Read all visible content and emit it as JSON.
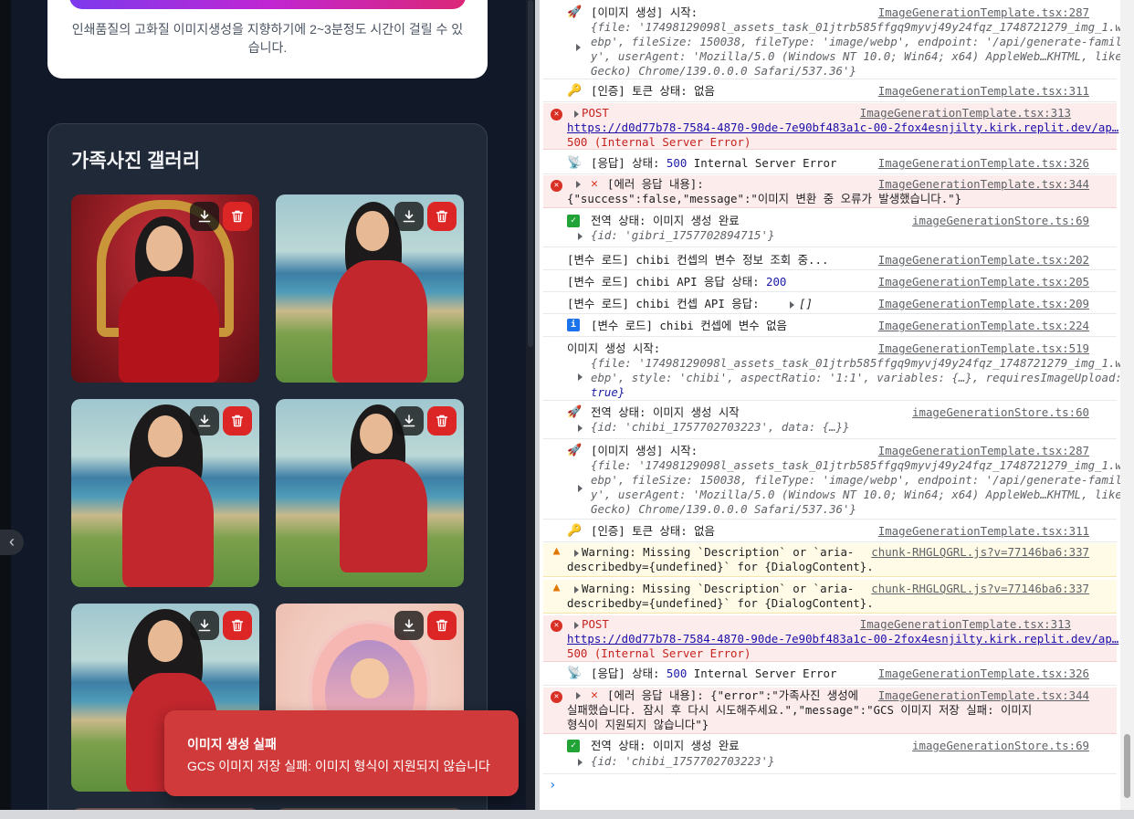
{
  "app": {
    "info_text": "인쇄품질의 고화질 이미지생성을 지향하기에 2~3분정도 시간이 걸릴 수 있습니다.",
    "gallery_title": "가족사진 갤러리",
    "toast": {
      "title": "이미지 생성 실패",
      "message": "GCS 이미지 저장 실패: 이미지 형식이 지원되지 않습니다"
    },
    "icons": {
      "download": "download-icon",
      "delete": "trash-icon",
      "collapse": "chevron-left-icon"
    }
  },
  "console": {
    "rows": [
      {
        "text": "[이미지 생성] 시작:",
        "src": "ImageGenerationTemplate.tsx:287",
        "obj": [
          "{file: '17498129098l_assets_task_01jtrb585ffgq9myvj49y24fqz_1748721279_img_1.w",
          "ebp', fileSize: 150038, fileType: 'image/webp', endpoint: '/api/generate-famil",
          "y', userAgent: 'Mozilla/5.0 (Windows NT 10.0; Win64; x64) AppleWeb…KHTML, like",
          "Gecko) Chrome/139.0.0.0 Safari/537.36'}"
        ]
      },
      {
        "text": "[인증] 토큰 상태: 없음",
        "src": "ImageGenerationTemplate.tsx:311"
      },
      {
        "text": "POST",
        "src": "ImageGenerationTemplate.tsx:313",
        "url": "https://d0d77b78-7584-4870-90de-7e90bf483a1c-00-2fox4esnjilty.kirk.replit.dev/ap…",
        "status": "500 (Internal Server Error)"
      },
      {
        "text": "[응답] 상태: ",
        "status_code": "500",
        "status_text": " Internal Server Error",
        "src": "ImageGenerationTemplate.tsx:326"
      },
      {
        "text": "[에러 응답 내용]:",
        "src": "ImageGenerationTemplate.tsx:344",
        "body": "{\"success\":false,\"message\":\"이미지 변환 중 오류가 발생했습니다.\"}"
      },
      {
        "text": "전역 상태: 이미지 생성 완료",
        "src": "imageGenerationStore.ts:69",
        "obj": "{id: 'gibri_1757702894715'}"
      },
      {
        "text": "[변수 로드] chibi 컨셉의 변수 정보 조회 중...",
        "src": "ImageGenerationTemplate.tsx:202"
      },
      {
        "text": "[변수 로드] chibi API 응답 상태: ",
        "value": "200",
        "src": "ImageGenerationTemplate.tsx:205"
      },
      {
        "text": "[변수 로드] chibi 컨셉 API 응답: ",
        "value": "[]",
        "src": "ImageGenerationTemplate.tsx:209"
      },
      {
        "text": "[변수 로드] chibi 컨셉에 변수 없음",
        "src": "ImageGenerationTemplate.tsx:224"
      },
      {
        "text": "이미지 생성 시작:",
        "src": "ImageGenerationTemplate.tsx:519",
        "obj": [
          "{file: '17498129098l_assets_task_01jtrb585ffgq9myvj49y24fqz_1748721279_img_1.w",
          "ebp', style: 'chibi', aspectRatio: '1:1', variables: {…}, requiresImageUpload:",
          "true}"
        ]
      },
      {
        "text": "전역 상태: 이미지 생성 시작",
        "src": "imageGenerationStore.ts:60",
        "obj": "{id: 'chibi_1757702703223', data: {…}}"
      },
      {
        "text": "[이미지 생성] 시작:",
        "src": "ImageGenerationTemplate.tsx:287",
        "obj": [
          "{file: '17498129098l_assets_task_01jtrb585ffgq9myvj49y24fqz_1748721279_img_1.w",
          "ebp', fileSize: 150038, fileType: 'image/webp', endpoint: '/api/generate-famil",
          "y', userAgent: 'Mozilla/5.0 (Windows NT 10.0; Win64; x64) AppleWeb…KHTML, like",
          "Gecko) Chrome/139.0.0.0 Safari/537.36'}"
        ]
      },
      {
        "text": "[인증] 토큰 상태: 없음",
        "src": "ImageGenerationTemplate.tsx:311"
      },
      {
        "text": "Warning: Missing `Description` or `aria-",
        "line2": "describedby={undefined}` for {DialogContent}.",
        "src": "chunk-RHGLQGRL.js?v=77146ba6:337"
      },
      {
        "text": "Warning: Missing `Description` or `aria-",
        "line2": "describedby={undefined}` for {DialogContent}.",
        "src": "chunk-RHGLQGRL.js?v=77146ba6:337"
      },
      {
        "text": "POST",
        "src": "ImageGenerationTemplate.tsx:313",
        "url": "https://d0d77b78-7584-4870-90de-7e90bf483a1c-00-2fox4esnjilty.kirk.replit.dev/ap…",
        "status": "500 (Internal Server Error)"
      },
      {
        "text": "[응답] 상태: ",
        "status_code": "500",
        "status_text": " Internal Server Error",
        "src": "ImageGenerationTemplate.tsx:326"
      },
      {
        "text": "[에러 응답 내용]: {\"error\":\"가족사진 생성에",
        "src": "ImageGenerationTemplate.tsx:344",
        "line2": "실패했습니다. 잠시 후 다시 시도해주세요.\",\"message\":\"GCS 이미지 저장 실패: 이미지",
        "line3": "형식이 지원되지 않습니다\"}"
      },
      {
        "text": "전역 상태: 이미지 생성 완료",
        "src": "imageGenerationStore.ts:69",
        "obj": "{id: 'chibi_1757702703223'}"
      }
    ],
    "prompt": "›"
  }
}
